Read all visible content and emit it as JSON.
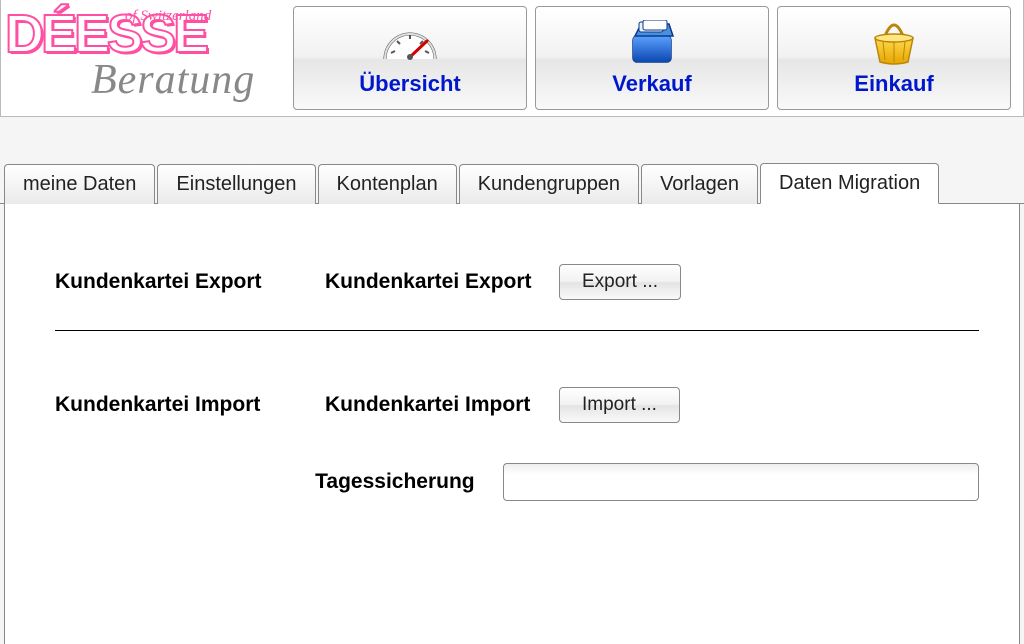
{
  "brand": {
    "name_main": "DÉESSE",
    "name_tag": "of Switzerland",
    "name_sub": "Beratung"
  },
  "nav": {
    "overview": "Übersicht",
    "sales": "Verkauf",
    "purchase": "Einkauf"
  },
  "tabs": {
    "mydata": "meine Daten",
    "settings": "Einstellungen",
    "accounts": "Kontenplan",
    "groups": "Kundengruppen",
    "templates": "Vorlagen",
    "migration": "Daten Migration"
  },
  "content": {
    "export_section_label": "Kundenkartei Export",
    "export_field_label": "Kundenkartei Export",
    "export_button": "Export ...",
    "import_section_label": "Kundenkartei Import",
    "import_field_label": "Kundenkartei Import",
    "import_button": "Import ...",
    "backup_label": "Tagessicherung",
    "backup_value": ""
  }
}
